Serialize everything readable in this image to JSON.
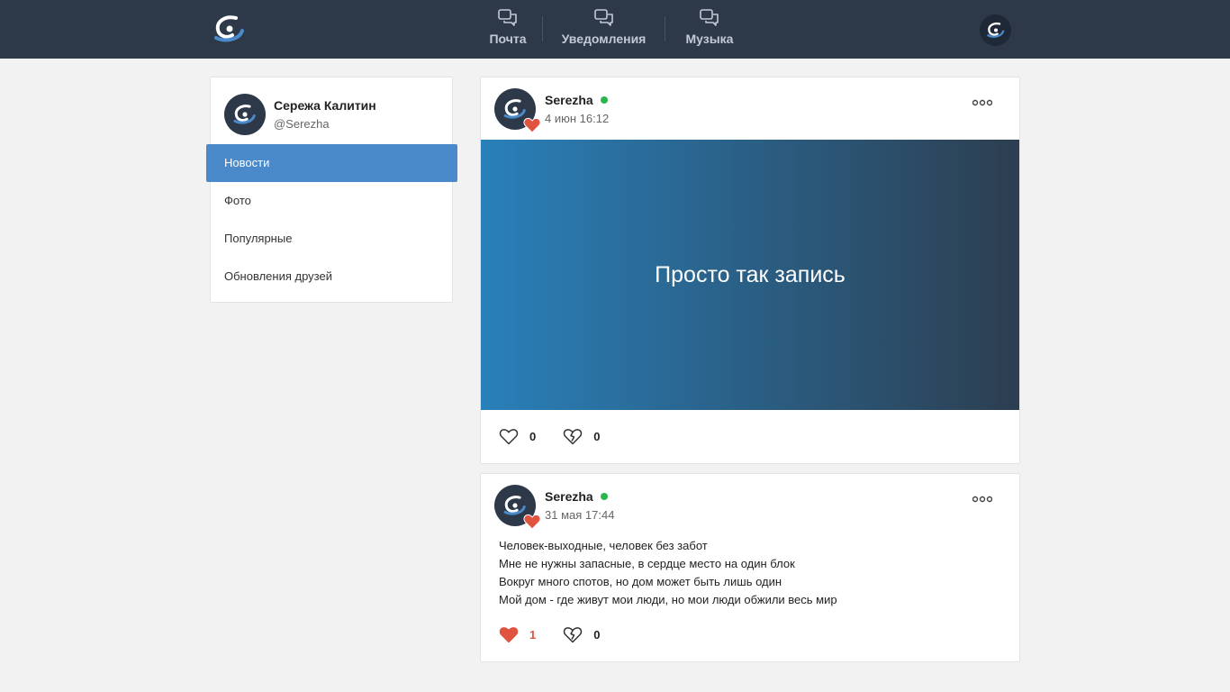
{
  "header": {
    "nav": [
      {
        "label": "Почта",
        "icon": "chat-icon"
      },
      {
        "label": "Уведомления",
        "icon": "chat-icon"
      },
      {
        "label": "Музыка",
        "icon": "chat-icon"
      }
    ]
  },
  "sidebar": {
    "profile": {
      "name": "Сережа Калитин",
      "handle": "@Serezha"
    },
    "menu": [
      {
        "label": "Новости",
        "active": true
      },
      {
        "label": "Фото"
      },
      {
        "label": "Популярные"
      },
      {
        "label": "Обновления друзей"
      }
    ]
  },
  "posts": [
    {
      "author": "Serezha",
      "date": "4 июн 16:12",
      "banner_text": "Просто так запись",
      "likes": "0",
      "dislikes": "0",
      "liked": false
    },
    {
      "author": "Serezha",
      "date": "31 мая 17:44",
      "lines": [
        "Человек-выходные, человек без забот",
        "Мне не нужны запасные, в сердце место на один блок",
        "Вокруг много спотов, но дом может быть лишь один",
        "Мой дом - где живут мои люди, но мои люди обжили весь мир"
      ],
      "likes": "1",
      "dislikes": "0",
      "liked": true
    }
  ],
  "colors": {
    "header_bg": "#2d3848",
    "accent": "#4a8acb",
    "online": "#2bb64a",
    "like": "#e0533f",
    "banner_gradient_start": "#2980ba",
    "banner_gradient_end": "#2c3e50"
  }
}
